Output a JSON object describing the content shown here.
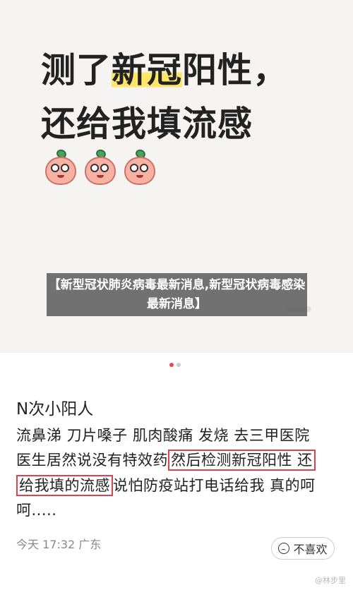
{
  "headline": {
    "line1_prefix": "测了",
    "line1_highlight": "新冠",
    "line1_suffix": "阳性，",
    "line2": "还给我填流感"
  },
  "emojis": [
    "peach-face-icon",
    "peach-face-icon",
    "peach-face-icon"
  ],
  "overlay_title": "【新型冠状肺炎病毒最新消息,新型冠状病毒感染最新消息】",
  "carousel": {
    "total": 2,
    "active": 1,
    "active_color": "#e44a5a"
  },
  "post": {
    "title": "N次小阳人",
    "line1": "流鼻涕 刀片嗓子 肌肉酸痛 发烧 去三甲医院",
    "line2_prefix": "医生居然说没有特效药",
    "line2_boxed": "然后检测新冠阳性 还",
    "line3_boxed": "给我填的流感",
    "line3_suffix": "说怕防疫站打电话给我 真的呵",
    "line4": "呵.....",
    "meta": "今天 17:32 广东",
    "dislike_label": "不喜欢"
  },
  "watermark": "@林步里",
  "colors": {
    "highlight": "#fde66a",
    "box_border": "#d9434f"
  }
}
